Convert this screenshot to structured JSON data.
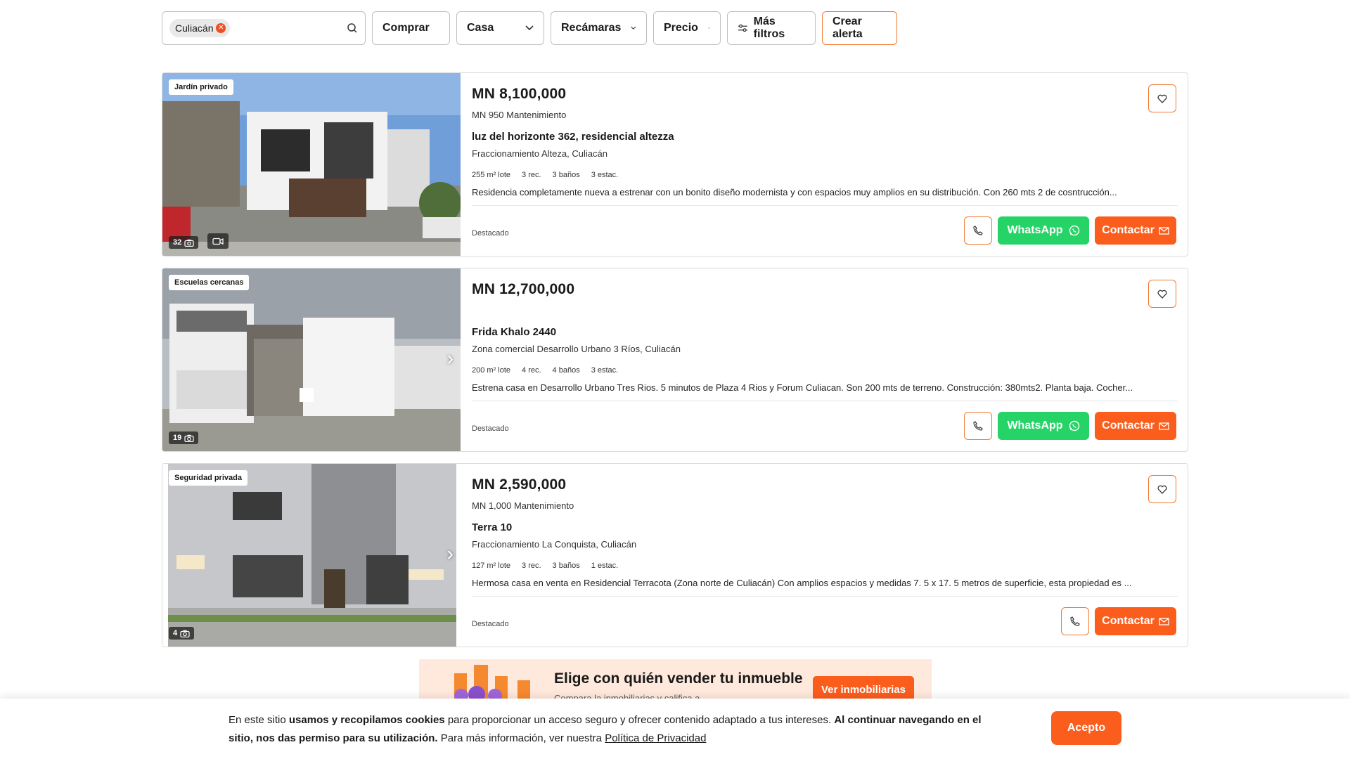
{
  "filters": {
    "location_chip": "Culiacán",
    "operation": "Comprar",
    "property_type": "Casa",
    "bedrooms": "Recámaras",
    "price": "Precio",
    "more_filters": "Más filtros",
    "create_alert": "Crear alerta"
  },
  "listings": [
    {
      "tag": "Jardín privado",
      "photo_count": "32",
      "has_video": true,
      "price": "MN 8,100,000",
      "maintenance": "MN 950 Mantenimiento",
      "address": "luz del horizonte 362, residencial altezza",
      "location": "Fraccionamiento Alteza, Culiacán",
      "features": [
        "255 m² lote",
        "3 rec.",
        "3 baños",
        "3 estac."
      ],
      "description": "Residencia completamente nueva a estrenar con un bonito diseño modernista y con espacios muy amplios en su distribución. Con 260 mts 2 de cosntrucción...",
      "badge": "Destacado",
      "whatsapp_label": "WhatsApp",
      "contact_label": "Contactar"
    },
    {
      "tag": "Escuelas cercanas",
      "photo_count": "19",
      "has_video": false,
      "price": "MN 12,700,000",
      "maintenance": "",
      "address": "Frida Khalo 2440",
      "location": "Zona comercial Desarrollo Urbano 3 Ríos, Culiacán",
      "features": [
        "200 m² lote",
        "4 rec.",
        "4 baños",
        "3 estac."
      ],
      "description": "Estrena casa en Desarrollo Urbano Tres Rios. 5 minutos de Plaza 4 Rios y Forum Culiacan. Son 200 mts de terreno. Construcción: 380mts2. Planta baja. Cocher...",
      "badge": "Destacado",
      "whatsapp_label": "WhatsApp",
      "contact_label": "Contactar"
    },
    {
      "tag": "Seguridad privada",
      "photo_count": "4",
      "has_video": false,
      "price": "MN 2,590,000",
      "maintenance": "MN 1,000 Mantenimiento",
      "address": "Terra 10",
      "location": "Fraccionamiento La Conquista, Culiacán",
      "features": [
        "127 m² lote",
        "3 rec.",
        "3 baños",
        "1 estac."
      ],
      "description": "Hermosa casa en venta en Residencial Terracota (Zona norte de Culiacán) Con amplios espacios y medidas 7. 5 x 17. 5 metros de superficie, esta propiedad es ...",
      "badge": "Destacado",
      "whatsapp_label": "",
      "contact_label": "Contactar"
    }
  ],
  "promo": {
    "title": "Elige con quién vender tu inmueble",
    "subtitle": "Compara la inmobiliarias y califica a ...",
    "button": "Ver inmobiliarias"
  },
  "cookie": {
    "t1": "En este sitio ",
    "b1": "usamos y recopilamos cookies",
    "t2": " para proporcionar un acceso seguro y ofrecer contenido adaptado a tus intereses. ",
    "b2": "Al continuar navegando en el sitio, nos das permiso para su utilización.",
    "t3": " Para más información, ver nuestra ",
    "link": "Política de Privacidad",
    "accept": "Acepto"
  },
  "colors": {
    "accent": "#fb5d1d",
    "whatsapp": "#26d366",
    "border": "#dcdcdc"
  }
}
